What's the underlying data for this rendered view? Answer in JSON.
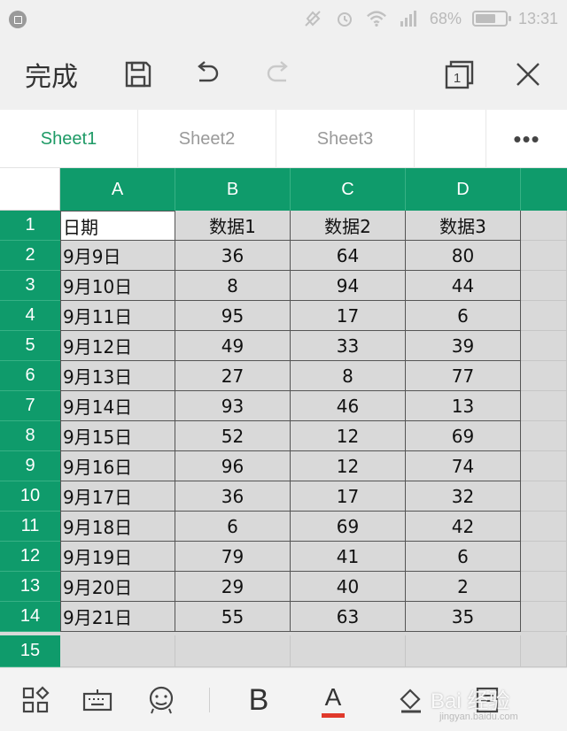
{
  "status_bar": {
    "battery_text": "68%",
    "battery_level": 0.68,
    "time": "13:31"
  },
  "toolbar": {
    "done_label": "完成",
    "icons": [
      "save-icon",
      "undo-icon",
      "redo-icon",
      "sheet-switch-icon",
      "close-icon"
    ],
    "sheet_switch_count": "1"
  },
  "tabs": [
    {
      "label": "Sheet1",
      "active": true
    },
    {
      "label": "Sheet2",
      "active": false
    },
    {
      "label": "Sheet3",
      "active": false
    }
  ],
  "more_label": "•••",
  "columns": [
    "A",
    "B",
    "C",
    "D"
  ],
  "row_numbers": [
    "1",
    "2",
    "3",
    "4",
    "5",
    "6",
    "7",
    "8",
    "9",
    "10",
    "11",
    "12",
    "13",
    "14",
    "15"
  ],
  "table": {
    "header": [
      "日期",
      "数据1",
      "数据2",
      "数据3"
    ],
    "rows": [
      [
        "9月9日",
        "36",
        "64",
        "80"
      ],
      [
        "9月10日",
        "8",
        "94",
        "44"
      ],
      [
        "9月11日",
        "95",
        "17",
        "6"
      ],
      [
        "9月12日",
        "49",
        "33",
        "39"
      ],
      [
        "9月13日",
        "27",
        "8",
        "77"
      ],
      [
        "9月14日",
        "93",
        "46",
        "13"
      ],
      [
        "9月15日",
        "52",
        "12",
        "69"
      ],
      [
        "9月16日",
        "96",
        "12",
        "74"
      ],
      [
        "9月17日",
        "36",
        "17",
        "32"
      ],
      [
        "9月18日",
        "6",
        "69",
        "42"
      ],
      [
        "9月19日",
        "79",
        "41",
        "6"
      ],
      [
        "9月20日",
        "29",
        "40",
        "2"
      ],
      [
        "9月21日",
        "55",
        "63",
        "35"
      ]
    ]
  },
  "bottom_toolbar": {
    "bold_label": "B",
    "font_color_label": "A",
    "font_color": "#e0392b",
    "icons": [
      "apps-icon",
      "keyboard-icon",
      "emoji-icon",
      "bold-icon",
      "font-color-icon",
      "fill-color-icon",
      "format-icon"
    ]
  },
  "watermark": {
    "text": "Bai 经验",
    "sub": "jingyan.baidu.com"
  },
  "colors": {
    "accent": "#0f9b6b",
    "tab_active": "#1e9a66",
    "cell_background": "#d9d9d9"
  }
}
